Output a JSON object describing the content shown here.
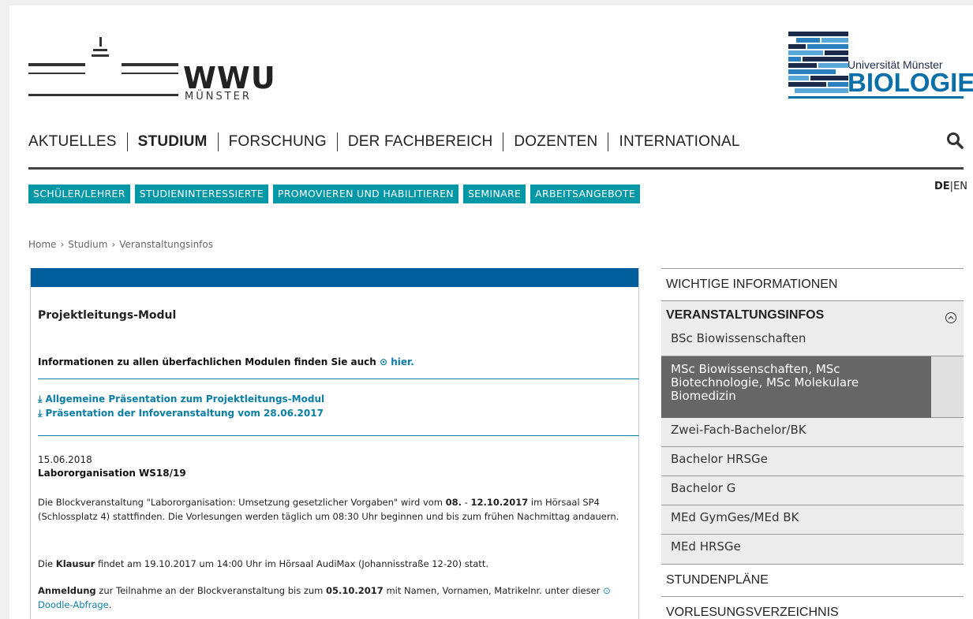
{
  "header": {
    "wwu_title": "WWU",
    "wwu_subtitle": "MÜNSTER",
    "bio_university": "Universität Münster",
    "bio_title": "BIOLOGIE"
  },
  "main_nav": {
    "items": [
      "AKTUELLES",
      "STUDIUM",
      "FORSCHUNG",
      "DER FACHBEREICH",
      "DOZENTEN",
      "INTERNATIONAL"
    ],
    "active": "STUDIUM"
  },
  "sub_nav": {
    "items": [
      "SCHÜLER/LEHRER",
      "STUDIENINTERESSIERTE",
      "PROMOVIEREN UND HABILITIEREN",
      "SEMINARE",
      "ARBEITSANGEBOTE"
    ]
  },
  "language": {
    "de": "DE",
    "sep": "|",
    "en": "EN"
  },
  "breadcrumb": [
    "Home",
    "›",
    "Studium",
    "›",
    "Veranstaltungsinfos"
  ],
  "content": {
    "title": "Projektleitungs-Modul",
    "info_text": "Informationen zu allen überfachlichen Modulen finden Sie auch ",
    "info_link": "hier.",
    "download_1": "Allgemeine Präsentation zum Projektleitungs-Modul",
    "download_2": "Präsentation der Infoveranstaltung vom 28.06.2017",
    "date": "15.06.2018",
    "subtitle": "Labororganisation WS18/19",
    "p1_a": "Die Blockveranstaltung \"Labororganisation: Umsetzung gesetzlicher Vorgaben\" wird vom ",
    "p1_b": "08.",
    "p1_c": " - ",
    "p1_d": "12.10.2017",
    "p1_e": " im Hörsaal SP4 (Schlossplatz 4) stattfinden. Die Vorlesungen werden täglich um 08:30 Uhr beginnen und bis zum frühen Nachmittag andauern.",
    "p2_a": "Die ",
    "p2_b": "Klausur",
    "p2_c": " findet am 19.10.2017 um 14:00 Uhr im Hörsaal AudiMax (Johannisstraße 12-20) statt.",
    "p3_a": "Anmeldung",
    "p3_b": " zur Teilnahme an der Blockveranstaltung bis zum ",
    "p3_c": "05.10.2017",
    "p3_d": " mit Namen, Vornamen, Matrikelnr. unter dieser ",
    "p3_link": "Doodle-Abfrage",
    "p3_e": "."
  },
  "sidebar": {
    "top": "WICHTIGE INFORMATIONEN",
    "group_title": "VERANSTALTUNGSINFOS",
    "group_items": [
      "BSc Biowissenschaften",
      "MSc Biowissenschaften, MSc Biotechnologie, MSc Molekulare Biomedizin",
      "Zwei-Fach-Bachelor/BK",
      "Bachelor HRSGe",
      "Bachelor G",
      "MEd GymGes/MEd BK",
      "MEd HRSGe"
    ],
    "after_1": "STUNDENPLÄNE",
    "after_2": "VORLESUNGSVERZEICHNIS"
  },
  "colors": {
    "teal": "#0097a7",
    "blue_bar": "#005e9c",
    "link": "#0a7ea6",
    "active_item_bg": "#666666"
  }
}
